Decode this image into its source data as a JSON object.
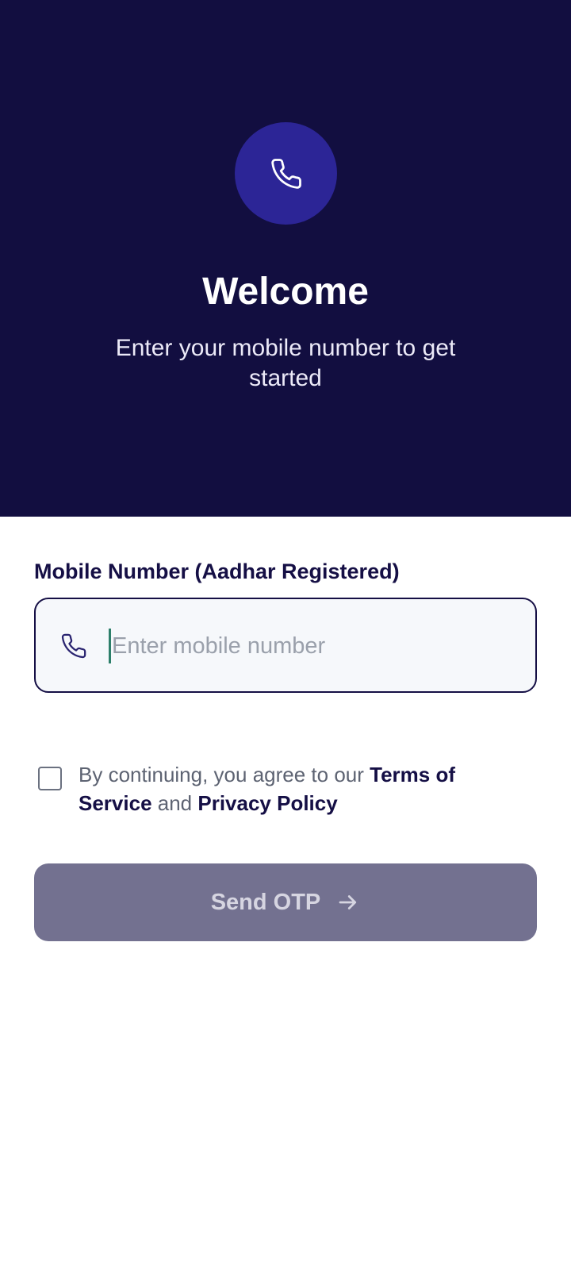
{
  "hero": {
    "icon": "phone-icon",
    "title": "Welcome",
    "subtitle": "Enter your mobile number to get started"
  },
  "form": {
    "label": "Mobile Number (Aadhar Registered)",
    "phone_placeholder": "Enter mobile number",
    "phone_value": "",
    "field_icon": "phone-icon"
  },
  "consent": {
    "checked": false,
    "prefix": "By continuing, you agree to our ",
    "terms_link": "Terms of Service",
    "joiner": " and ",
    "privacy_link": "Privacy Policy"
  },
  "actions": {
    "send_label": "Send OTP",
    "send_icon": "arrow-right-icon",
    "send_enabled": false
  },
  "colors": {
    "hero_bg": "#120e40",
    "icon_circle": "#2c2596",
    "accent": "#150f45",
    "button_disabled": "#737190"
  }
}
